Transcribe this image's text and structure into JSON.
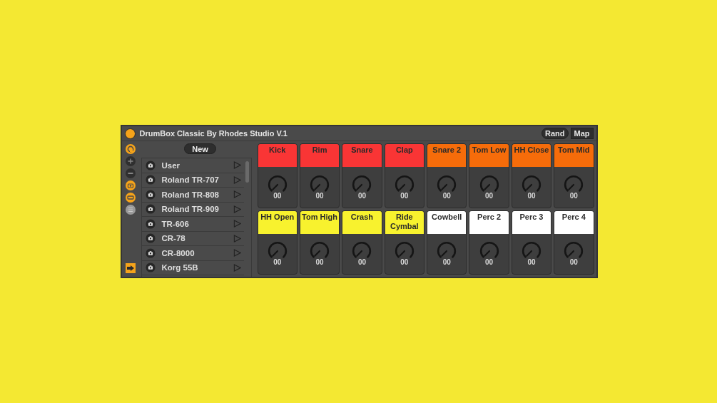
{
  "device": {
    "title": "DrumBox Classic By Rhodes Studio V.1",
    "buttons": [
      {
        "label": "Rand",
        "kind": "pill"
      },
      {
        "label": "Map",
        "kind": "square"
      }
    ]
  },
  "browser": {
    "new_button": "New",
    "presets": [
      {
        "name": "User"
      },
      {
        "name": "Roland TR-707"
      },
      {
        "name": "Roland TR-808"
      },
      {
        "name": "Roland TR-909"
      },
      {
        "name": "TR-606"
      },
      {
        "name": "CR-78"
      },
      {
        "name": "CR-8000"
      },
      {
        "name": "Korg 55B"
      }
    ]
  },
  "pads": [
    {
      "label": "Kick",
      "color": "#f93535",
      "value": "00"
    },
    {
      "label": "Rim",
      "color": "#f93535",
      "value": "00"
    },
    {
      "label": "Snare",
      "color": "#f93535",
      "value": "00"
    },
    {
      "label": "Clap",
      "color": "#f93535",
      "value": "00"
    },
    {
      "label": "Snare 2",
      "color": "#f66c0a",
      "value": "00"
    },
    {
      "label": "Tom Low",
      "color": "#f66c0a",
      "value": "00"
    },
    {
      "label": "HH Close",
      "color": "#f66c0a",
      "value": "00"
    },
    {
      "label": "Tom Mid",
      "color": "#f66c0a",
      "value": "00"
    },
    {
      "label": "HH Open",
      "color": "#f8f22e",
      "value": "00"
    },
    {
      "label": "Tom High",
      "color": "#f8f22e",
      "value": "00"
    },
    {
      "label": "Crash",
      "color": "#f8f22e",
      "value": "00"
    },
    {
      "label": "Ride Cymbal",
      "color": "#f8f22e",
      "value": "00"
    },
    {
      "label": "Cowbell",
      "color": "#ffffff",
      "value": "00"
    },
    {
      "label": "Perc 2",
      "color": "#ffffff",
      "value": "00"
    },
    {
      "label": "Perc 3",
      "color": "#ffffff",
      "value": "00"
    },
    {
      "label": "Perc 4",
      "color": "#ffffff",
      "value": "00"
    }
  ]
}
